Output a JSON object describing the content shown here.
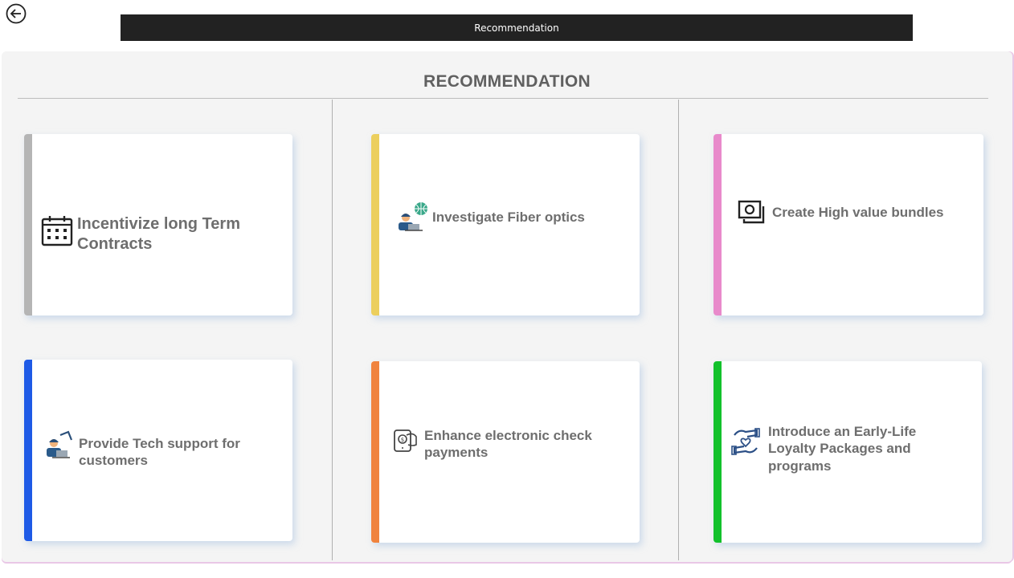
{
  "header": {
    "title": "Recommendation",
    "back_icon": "back-arrow-circle-icon"
  },
  "panel": {
    "title": "RECOMMENDATION"
  },
  "cards": [
    {
      "label": "Incentivize long Term Contracts",
      "icon": "calendar-icon",
      "accent": "#b5b5b5"
    },
    {
      "label": "Investigate Fiber optics",
      "icon": "technician-globe-icon",
      "accent": "#eccf5e"
    },
    {
      "label": "Create High value bundles",
      "icon": "money-bundle-icon",
      "accent": "#e88acb"
    },
    {
      "label": "Provide Tech support for customers",
      "icon": "tech-support-icon",
      "accent": "#1e5ae6"
    },
    {
      "label": "Enhance electronic check payments",
      "icon": "electronic-check-icon",
      "accent": "#f0833e"
    },
    {
      "label": "Introduce an Early-Life Loyalty Packages and programs",
      "icon": "loyalty-hands-icon",
      "accent": "#12c12b"
    }
  ]
}
